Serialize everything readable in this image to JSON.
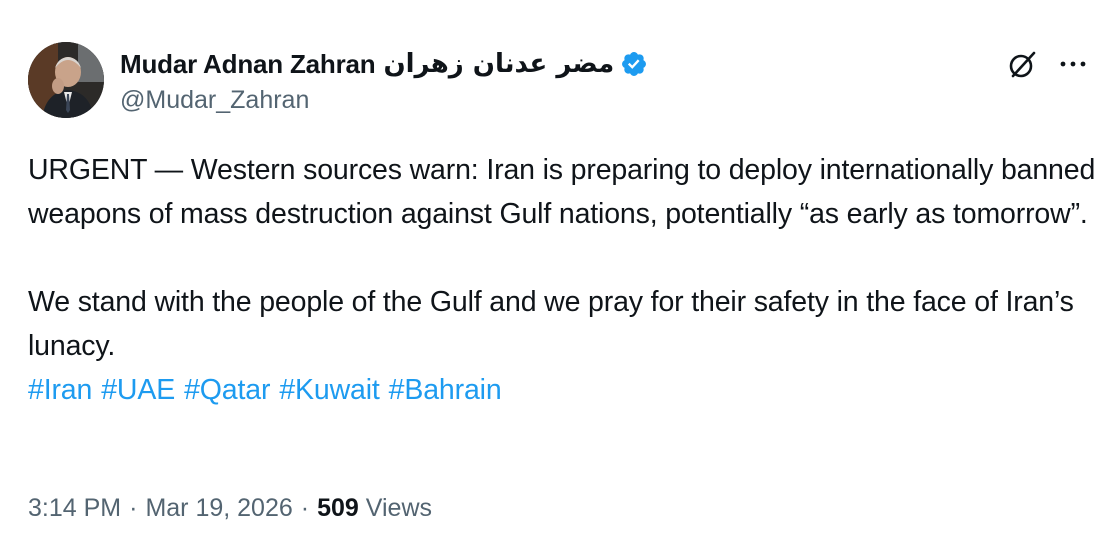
{
  "author": {
    "display_name": "Mudar Adnan Zahran",
    "display_name_arabic": "مضر عدنان زهران",
    "handle": "@Mudar_Zahran",
    "verified": true
  },
  "actions": {
    "grok_icon": "grok-icon",
    "more_icon": "more-options-icon"
  },
  "tweet": {
    "paragraph_1": "URGENT — Western sources warn: Iran is preparing to deploy internationally banned weapons of mass destruction against Gulf nations, potentially “as early as tomorrow”.",
    "paragraph_2": "We stand with the people of the Gulf and we pray for their safety in the face of Iran’s lunacy.",
    "hashtags": [
      "#Iran",
      "#UAE",
      "#Qatar",
      "#Kuwait",
      "#Bahrain"
    ]
  },
  "meta": {
    "time": "3:14 PM",
    "separator": "·",
    "date": "Mar 19, 2026",
    "views_count": "509",
    "views_label": "Views"
  },
  "colors": {
    "text": "#0f1419",
    "secondary": "#536471",
    "link": "#1d9bf0",
    "verified": "#1d9bf0"
  }
}
